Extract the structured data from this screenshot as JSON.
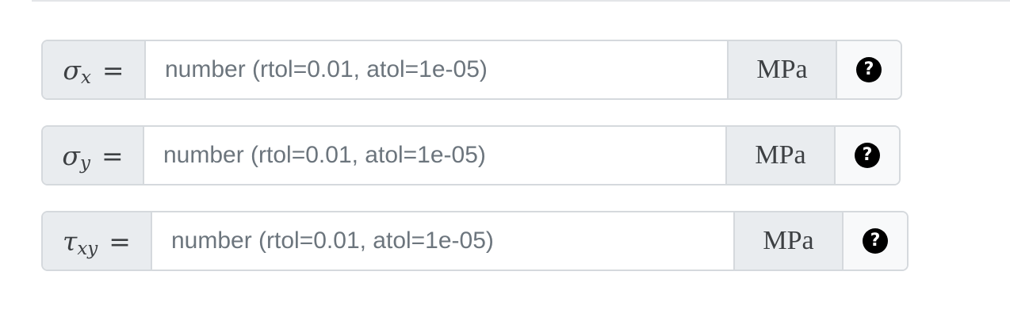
{
  "fields": [
    {
      "symbol": "σ",
      "subscript": "x",
      "equals": "=",
      "placeholder": "number (rtol=0.01, atol=1e-05)",
      "value": "",
      "unit": "MPa",
      "help_icon": "question-circle-icon",
      "help_glyph": "?"
    },
    {
      "symbol": "σ",
      "subscript": "y",
      "equals": "=",
      "placeholder": "number (rtol=0.01, atol=1e-05)",
      "value": "",
      "unit": "MPa",
      "help_icon": "question-circle-icon",
      "help_glyph": "?"
    },
    {
      "symbol": "τ",
      "subscript": "xy",
      "equals": "=",
      "placeholder": "number (rtol=0.01, atol=1e-05)",
      "value": "",
      "unit": "MPa",
      "help_icon": "question-circle-icon",
      "help_glyph": "?"
    }
  ]
}
